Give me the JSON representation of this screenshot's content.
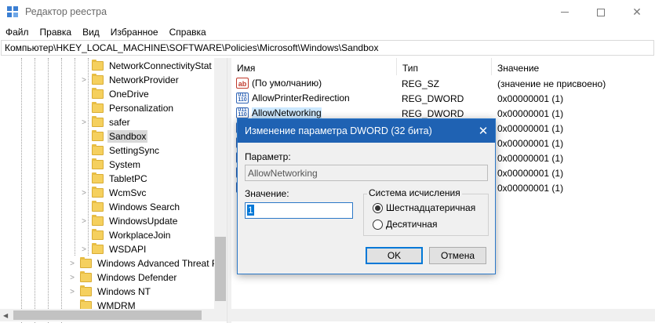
{
  "window": {
    "title": "Редактор реестра",
    "icon": "registry-editor-icon"
  },
  "menu": [
    "Файл",
    "Правка",
    "Вид",
    "Избранное",
    "Справка"
  ],
  "address": "Компьютер\\HKEY_LOCAL_MACHINE\\SOFTWARE\\Policies\\Microsoft\\Windows\\Sandbox",
  "tree": {
    "items": [
      {
        "label": "NetworkConnectivityStat",
        "expander": ""
      },
      {
        "label": "NetworkProvider",
        "expander": ">"
      },
      {
        "label": "OneDrive",
        "expander": ""
      },
      {
        "label": "Personalization",
        "expander": ""
      },
      {
        "label": "safer",
        "expander": ">"
      },
      {
        "label": "Sandbox",
        "expander": "",
        "selected": true
      },
      {
        "label": "SettingSync",
        "expander": ""
      },
      {
        "label": "System",
        "expander": ""
      },
      {
        "label": "TabletPC",
        "expander": ""
      },
      {
        "label": "WcmSvc",
        "expander": ">"
      },
      {
        "label": "Windows Search",
        "expander": ""
      },
      {
        "label": "WindowsUpdate",
        "expander": ">"
      },
      {
        "label": "WorkplaceJoin",
        "expander": ""
      },
      {
        "label": "WSDAPI",
        "expander": ">"
      },
      {
        "label": "Windows Advanced Threat P",
        "expander": ">"
      },
      {
        "label": "Windows Defender",
        "expander": ">"
      },
      {
        "label": "Windows NT",
        "expander": ">"
      },
      {
        "label": "WMDRM",
        "expander": ""
      }
    ]
  },
  "list": {
    "headers": {
      "name": "Имя",
      "type": "Тип",
      "value": "Значение"
    },
    "rows": [
      {
        "icon": "ab",
        "name": "(По умолчанию)",
        "type": "REG_SZ",
        "value": "(значение не присвоено)"
      },
      {
        "icon": "dword",
        "name": "AllowPrinterRedirection",
        "type": "REG_DWORD",
        "value": "0x00000001 (1)"
      },
      {
        "icon": "dword",
        "name": "AllowNetworking",
        "type": "REG_DWORD",
        "value": "0x00000001 (1)",
        "selected": true
      },
      {
        "icon": "dword",
        "name": "",
        "type": "",
        "value": "0x00000001 (1)"
      },
      {
        "icon": "dword",
        "name": "",
        "type": "",
        "value": "0x00000001 (1)"
      },
      {
        "icon": "dword",
        "name": "",
        "type": "",
        "value": "0x00000001 (1)"
      },
      {
        "icon": "dword",
        "name": "",
        "type": "",
        "value": "0x00000001 (1)"
      },
      {
        "icon": "dword",
        "name": "",
        "type": "",
        "value": "0x00000001 (1)"
      }
    ]
  },
  "dialog": {
    "title": "Изменение параметра DWORD (32 бита)",
    "param_label": "Параметр:",
    "param_value": "AllowNetworking",
    "value_label": "Значение:",
    "value": "1",
    "base_group": "Система исчисления",
    "base_hex": "Шестнадцатеричная",
    "base_dec": "Десятичная",
    "selected_base": "hex",
    "ok_label": "OK",
    "cancel_label": "Отмена"
  }
}
